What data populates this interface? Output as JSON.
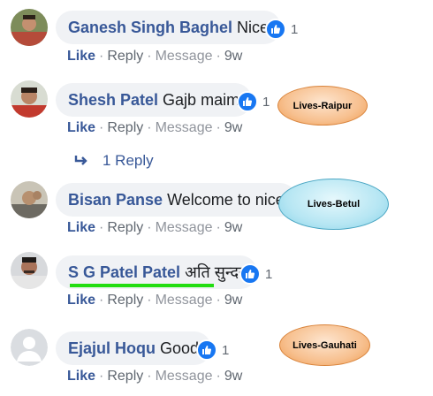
{
  "comments": [
    {
      "author": "Ganesh Singh Baghel",
      "text": "Nice",
      "reactions": "1",
      "actions": {
        "like": "Like",
        "reply": "Reply",
        "message": "Message",
        "time": "9w"
      }
    },
    {
      "author": "Shesh Patel",
      "text": "Gajb maim",
      "reactions": "1",
      "actions": {
        "like": "Like",
        "reply": "Reply",
        "message": "Message",
        "time": "9w"
      },
      "replies_link": "1 Reply"
    },
    {
      "author": "Bisan Panse",
      "text": "Welcome to nice",
      "actions": {
        "like": "Like",
        "reply": "Reply",
        "message": "Message",
        "time": "9w"
      }
    },
    {
      "author": "S G Patel Patel",
      "text": "अति सुन्दर",
      "reactions": "1",
      "actions": {
        "like": "Like",
        "reply": "Reply",
        "message": "Message",
        "time": "9w"
      }
    },
    {
      "author": "Ejajul Hoqu",
      "text": "Good",
      "reactions": "1",
      "actions": {
        "like": "Like",
        "reply": "Reply",
        "message": "Message",
        "time": "9w"
      }
    }
  ],
  "callouts": [
    "Lives-Raipur",
    "Lives-Betul",
    "Lives-Gauhati"
  ],
  "colors": {
    "author": "#385898",
    "bubble": "#f0f2f5",
    "like_badge": "#1877f2",
    "underline": "#22dd11"
  }
}
